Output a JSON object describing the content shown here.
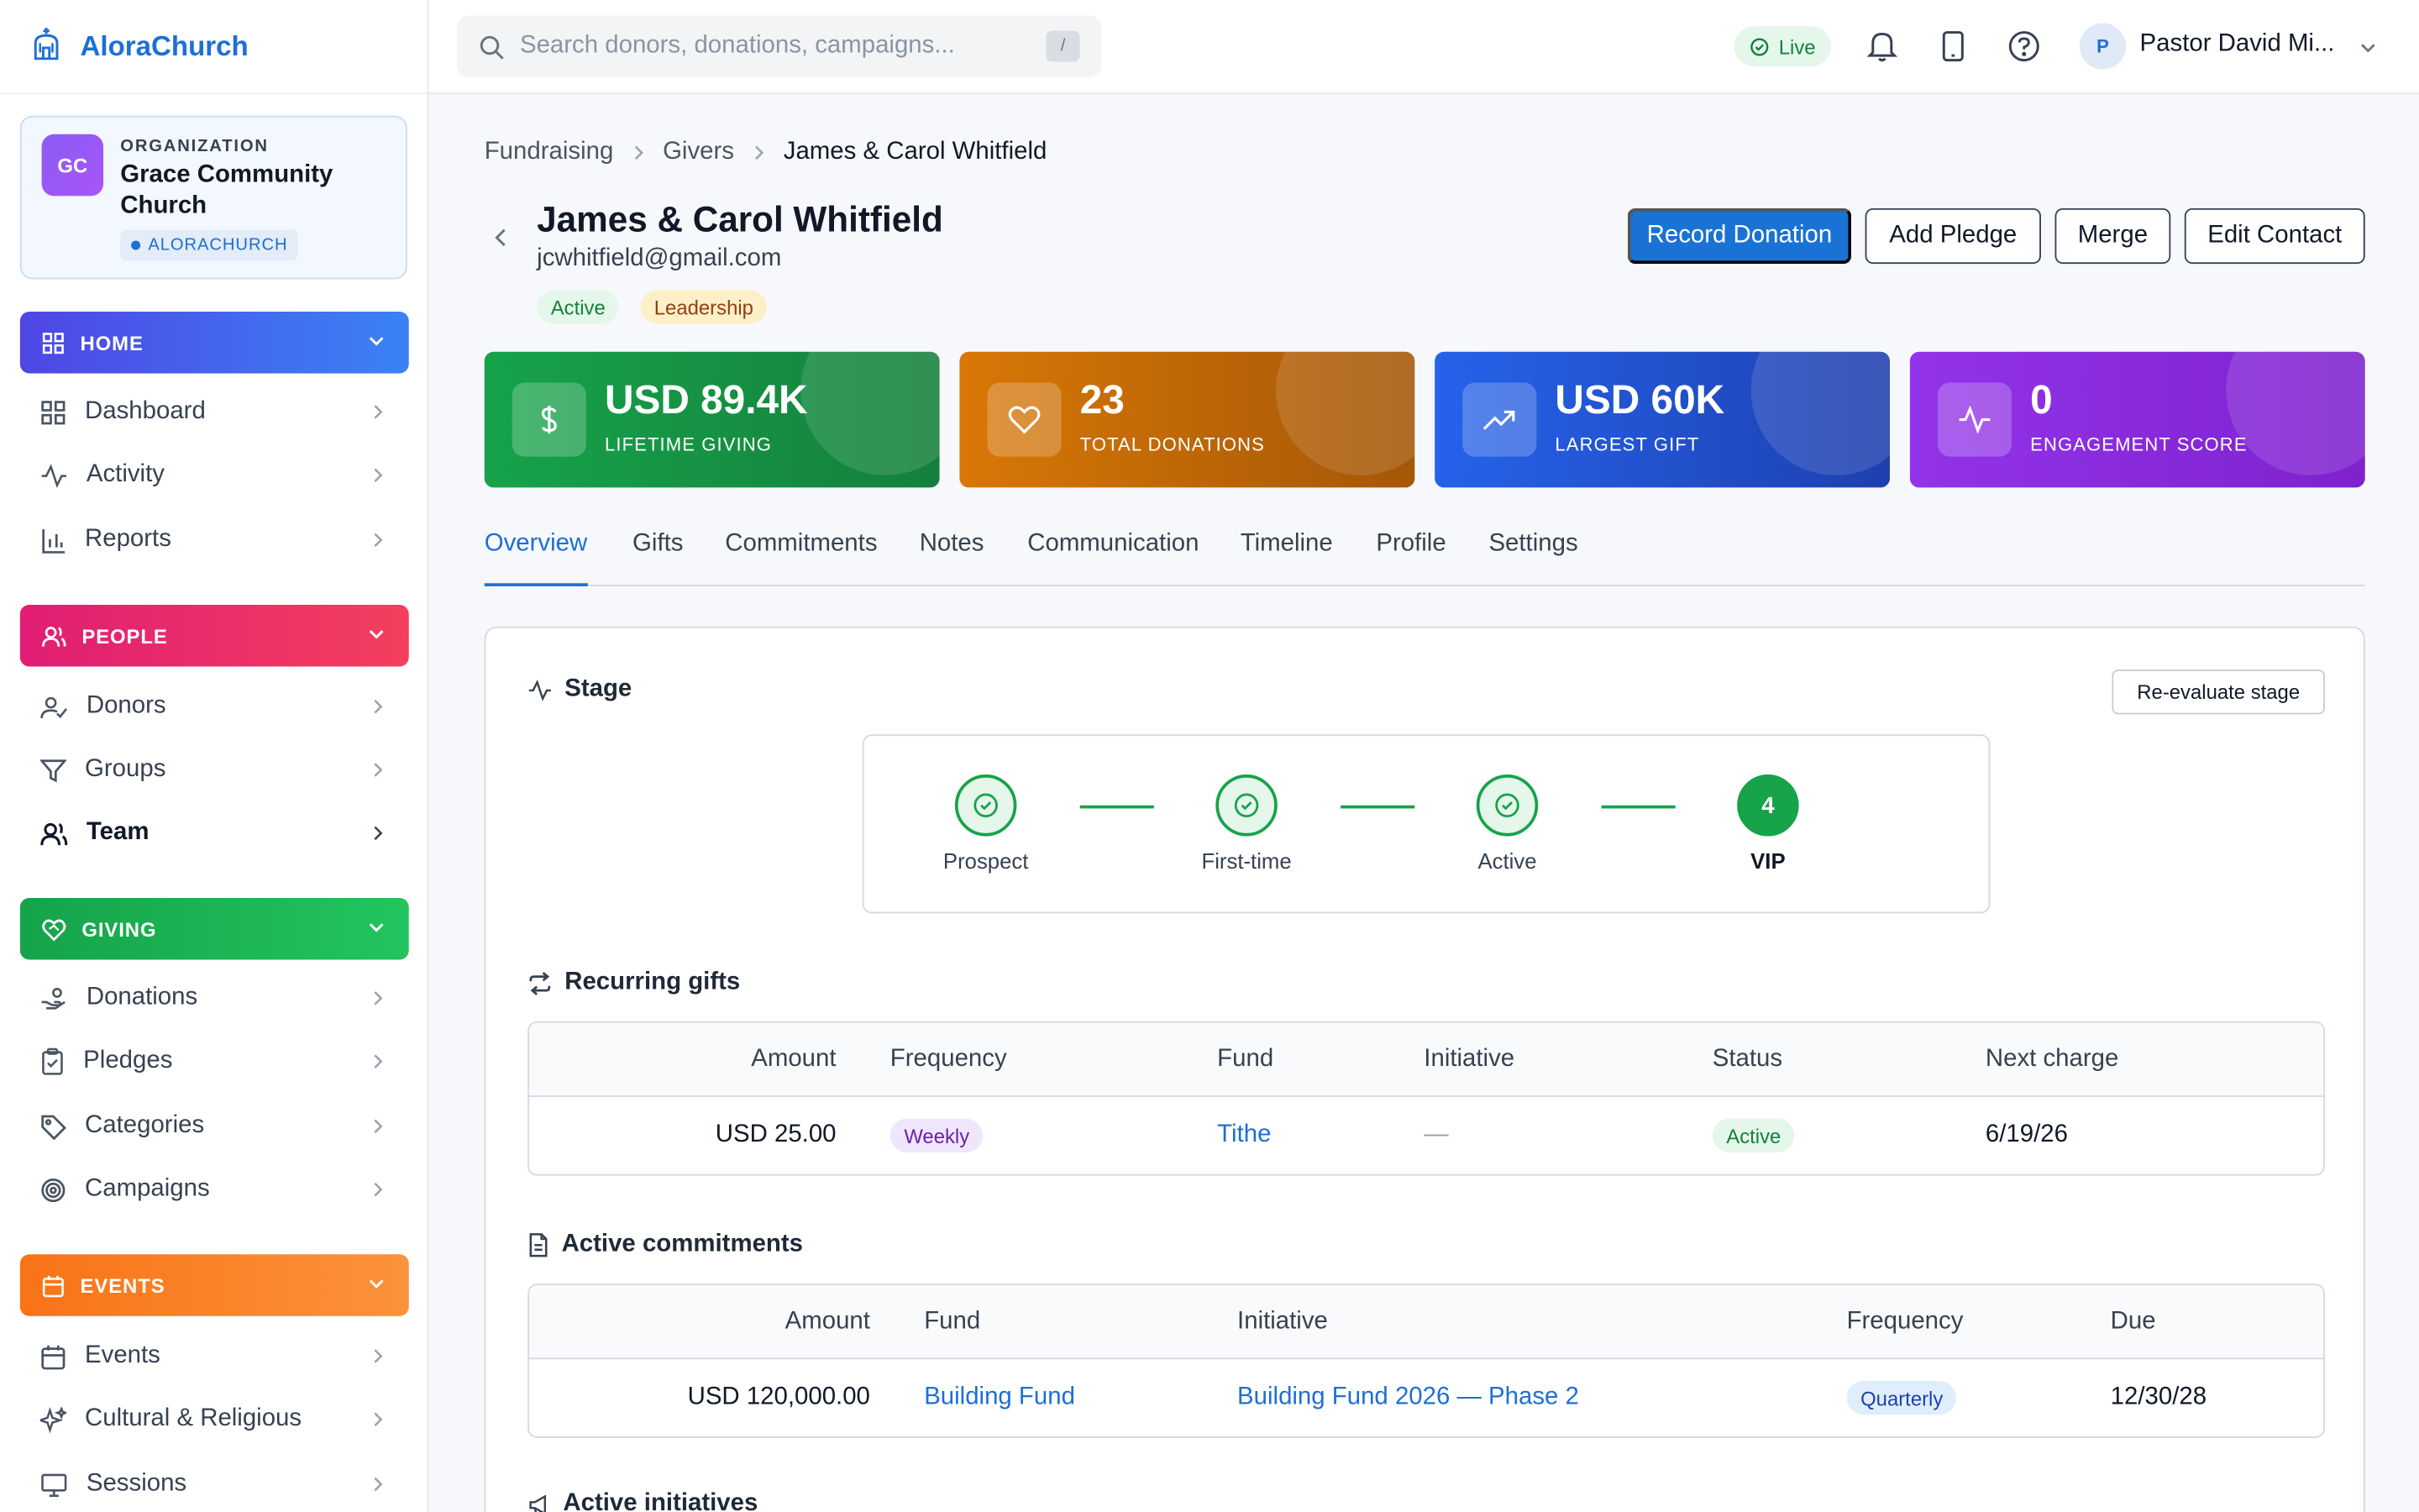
{
  "app": {
    "brand": "AloraChurch"
  },
  "org": {
    "label": "ORGANIZATION",
    "name": "Grace Community Church",
    "initials": "GC",
    "tag": "ALORACHURCH"
  },
  "sidebar": {
    "sections": [
      {
        "label": "HOME",
        "color": "#4f46e5",
        "items": [
          "Dashboard",
          "Activity",
          "Reports"
        ]
      },
      {
        "label": "PEOPLE",
        "color": "#e11d74",
        "items": [
          "Donors",
          "Groups",
          "Team"
        ]
      },
      {
        "label": "GIVING",
        "color": "#16a34a",
        "items": [
          "Donations",
          "Pledges",
          "Categories",
          "Campaigns"
        ]
      },
      {
        "label": "EVENTS",
        "color": "#f97316",
        "items": [
          "Events",
          "Cultural & Religious",
          "Sessions"
        ]
      }
    ]
  },
  "topbar": {
    "search_placeholder": "Search donors, donations, campaigns...",
    "search_shortcut": "/",
    "live_label": "Live",
    "user_initial": "P",
    "user_name": "Pastor David Mi..."
  },
  "breadcrumb": [
    "Fundraising",
    "Givers",
    "James & Carol Whitfield"
  ],
  "contact": {
    "name": "James & Carol Whitfield",
    "email": "jcwhitfield@gmail.com",
    "tags": [
      "Active",
      "Leadership"
    ]
  },
  "actions": [
    "Record Donation",
    "Add Pledge",
    "Merge",
    "Edit Contact"
  ],
  "kpis": [
    {
      "value": "USD 89.4K",
      "label": "LIFETIME GIVING",
      "icon": "dollar-icon",
      "color_from": "#16a34a",
      "color_to": "#15803d"
    },
    {
      "value": "23",
      "label": "TOTAL DONATIONS",
      "icon": "heart-icon",
      "color_from": "#d97706",
      "color_to": "#b45309"
    },
    {
      "value": "USD 60K",
      "label": "LARGEST GIFT",
      "icon": "trending-up-icon",
      "color_from": "#2563eb",
      "color_to": "#1d4ed8"
    },
    {
      "value": "0",
      "label": "ENGAGEMENT SCORE",
      "icon": "activity-icon",
      "color_from": "#9333ea",
      "color_to": "#7e22ce"
    }
  ],
  "tabs": [
    "Overview",
    "Gifts",
    "Commitments",
    "Notes",
    "Communication",
    "Timeline",
    "Profile",
    "Settings"
  ],
  "stage": {
    "title": "Stage",
    "reevaluate_label": "Re-evaluate stage",
    "steps": [
      "Prospect",
      "First-time",
      "Active",
      "VIP"
    ],
    "current_number": "4"
  },
  "recurring": {
    "title": "Recurring gifts",
    "headers": [
      "Amount",
      "Frequency",
      "Fund",
      "Initiative",
      "Status",
      "Next charge"
    ],
    "rows": [
      {
        "amount": "USD 25.00",
        "frequency": "Weekly",
        "fund": "Tithe",
        "initiative": "—",
        "status": "Active",
        "next": "6/19/26"
      }
    ]
  },
  "commitments": {
    "title": "Active commitments",
    "headers": [
      "Amount",
      "Fund",
      "Initiative",
      "Frequency",
      "Due"
    ],
    "rows": [
      {
        "amount": "USD 120,000.00",
        "fund": "Building Fund",
        "initiative": "Building Fund 2026 — Phase 2",
        "frequency": "Quarterly",
        "due": "12/30/28"
      }
    ]
  },
  "initiatives": {
    "title": "Active initiatives"
  }
}
